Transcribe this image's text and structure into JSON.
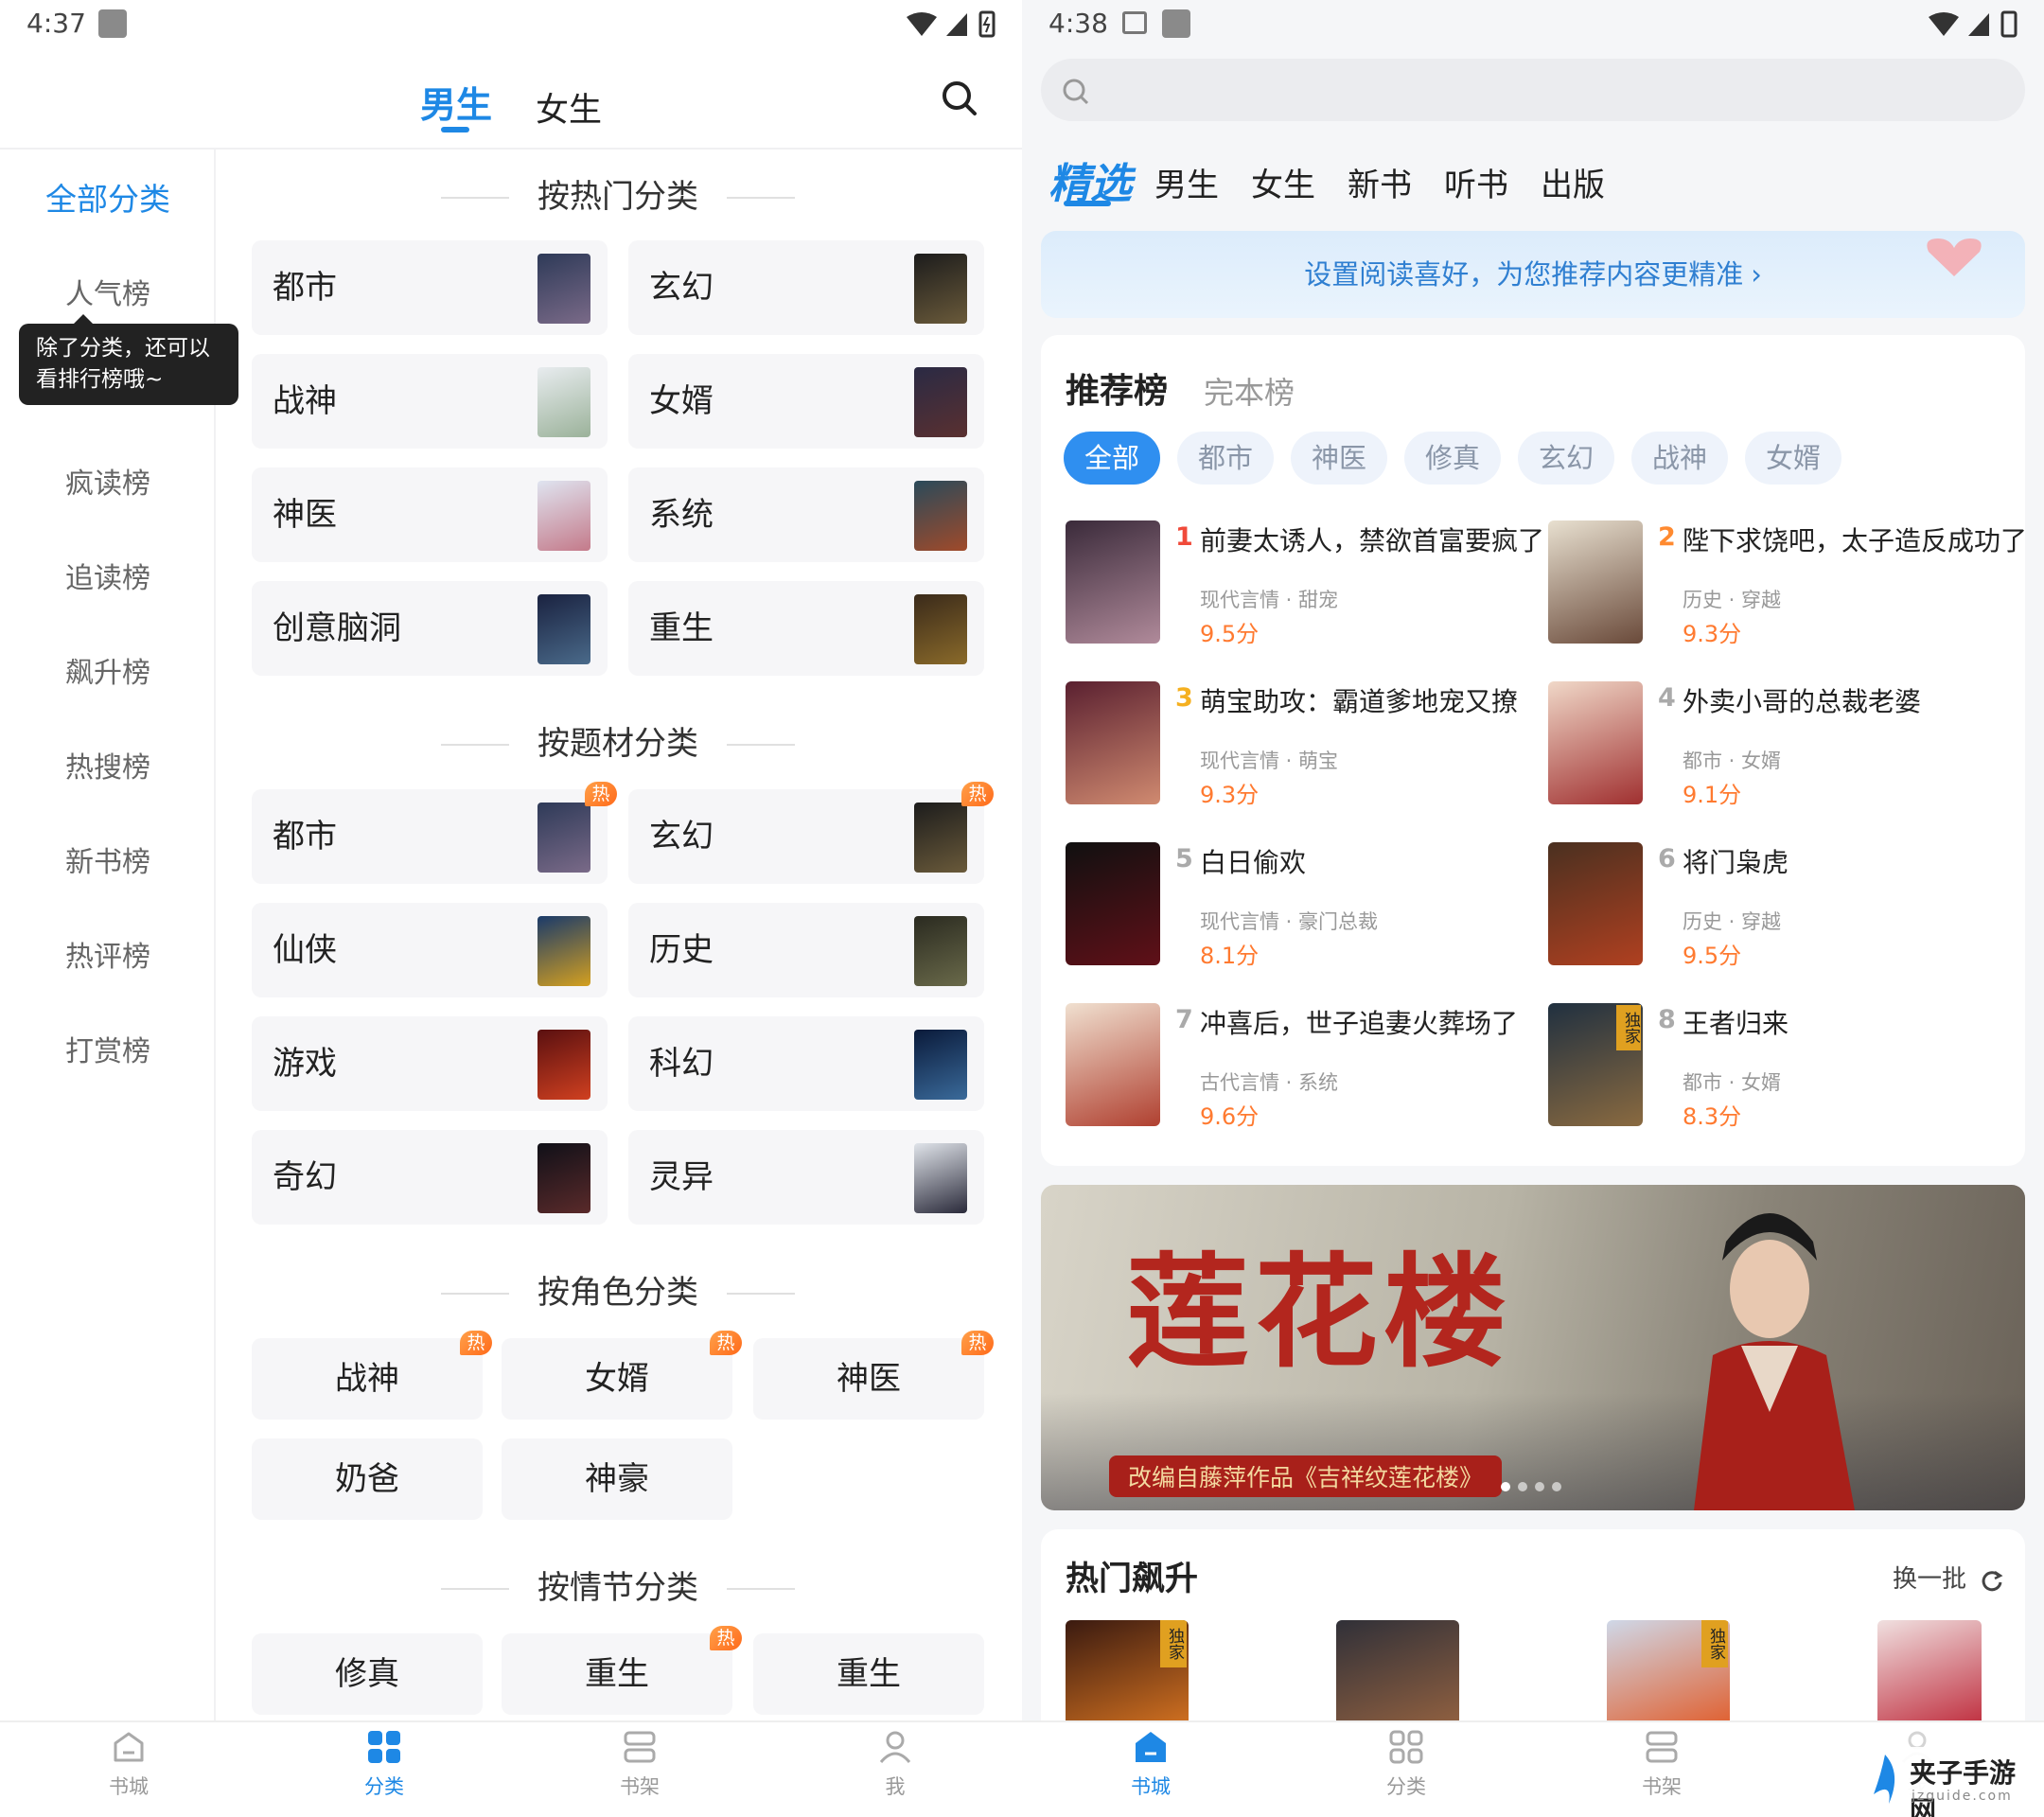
{
  "left": {
    "status": {
      "time": "4:37"
    },
    "gender_tabs": {
      "male": "男生",
      "female": "女生"
    },
    "sidebar": {
      "items": [
        "全部分类",
        "人气榜",
        "疯读榜",
        "追读榜",
        "飙升榜",
        "热搜榜",
        "新书榜",
        "热评榜",
        "打赏榜"
      ],
      "tooltip_line1": "除了分类，还可以",
      "tooltip_line2": "看排行榜哦~"
    },
    "sections": {
      "popular": {
        "title": "按热门分类",
        "items": [
          "都市",
          "玄幻",
          "战神",
          "女婿",
          "神医",
          "系统",
          "创意脑洞",
          "重生"
        ]
      },
      "theme": {
        "title": "按题材分类",
        "items": [
          "都市",
          "玄幻",
          "仙侠",
          "历史",
          "游戏",
          "科幻",
          "奇幻",
          "灵异"
        ]
      },
      "role": {
        "title": "按角色分类",
        "items": [
          "战神",
          "女婿",
          "神医",
          "奶爸",
          "神豪"
        ]
      },
      "plot": {
        "title": "按情节分类",
        "items": [
          "修真",
          "重生",
          "重生"
        ]
      }
    },
    "hot_badge": "热",
    "bottom_nav": [
      "书城",
      "分类",
      "书架",
      "我"
    ]
  },
  "right": {
    "status": {
      "time": "4:38"
    },
    "channel_tabs": [
      "精选",
      "男生",
      "女生",
      "新书",
      "听书",
      "出版"
    ],
    "banner_text": "设置阅读喜好，为您推荐内容更精准",
    "rank_tabs": {
      "active": "推荐榜",
      "other": "完本榜"
    },
    "chips": [
      "全部",
      "都市",
      "神医",
      "修真",
      "玄幻",
      "战神",
      "女婿"
    ],
    "books": [
      {
        "rank": "1",
        "title": "前妻太诱人，禁欲首富要疯了",
        "tags": "现代言情 · 甜宠",
        "score": "9.5分"
      },
      {
        "rank": "2",
        "title": "陛下求饶吧，太子造反成功了",
        "tags": "历史 · 穿越",
        "score": "9.3分"
      },
      {
        "rank": "3",
        "title": "萌宝助攻：霸道爹地宠又撩",
        "tags": "现代言情 · 萌宝",
        "score": "9.3分"
      },
      {
        "rank": "4",
        "title": "外卖小哥的总裁老婆",
        "tags": "都市 · 女婿",
        "score": "9.1分"
      },
      {
        "rank": "5",
        "title": "白日偷欢",
        "tags": "现代言情 · 豪门总裁",
        "score": "8.1分"
      },
      {
        "rank": "6",
        "title": "将门枭虎",
        "tags": "历史 · 穿越",
        "score": "9.5分"
      },
      {
        "rank": "7",
        "title": "冲喜后，世子追妻火葬场了",
        "tags": "古代言情 · 系统",
        "score": "9.6分"
      },
      {
        "rank": "8",
        "title": "王者归来",
        "tags": "都市 · 女婿",
        "score": "8.3分"
      }
    ],
    "promo": {
      "title": "莲花楼",
      "caption": "改编自藤萍作品《吉祥纹莲花楼》"
    },
    "hot_rise": {
      "title": "热门飙升",
      "refresh": "换一批"
    },
    "exclusive_badge": "独家",
    "bottom_nav": [
      "书城",
      "分类",
      "书架",
      "我"
    ],
    "watermark": {
      "name": "夹子手游网",
      "url": "jzguide.com"
    }
  }
}
